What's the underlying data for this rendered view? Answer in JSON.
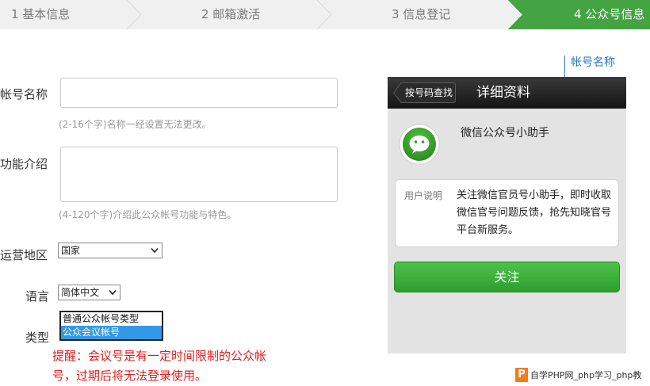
{
  "steps": [
    {
      "label": "1 基本信息",
      "active": false
    },
    {
      "label": "2 邮箱激活",
      "active": false
    },
    {
      "label": "3 信息登记",
      "active": false
    },
    {
      "label": "4 公众号信息",
      "active": true
    }
  ],
  "form": {
    "account_name": {
      "label": "帐号名称",
      "value": "",
      "hint": "(2-16个字)名称一经设置无法更改。"
    },
    "function_intro": {
      "label": "功能介绍",
      "value": "",
      "hint": "(4-120个字)介绍此公众帐号功能与特色。"
    },
    "region": {
      "label": "运营地区",
      "selected": "国家"
    },
    "language": {
      "label": "语言",
      "selected": "简体中文"
    },
    "type": {
      "label": "类型",
      "options": [
        "普通公众帐号类型",
        "公众会议帐号"
      ],
      "selected_index": 1
    },
    "warning": "提醒：会议号是有一定时间限制的公众帐号，过期后将无法登录使用。"
  },
  "annotation": {
    "label": "帐号名称"
  },
  "preview": {
    "back_label": "按号码查找",
    "title": "详细资料",
    "account_name": "微信公众号小助手",
    "desc_label": "用户说明",
    "desc_text": "关注微信官员号小助手，即时收取微信官号问题反馈，抢先知晓官号平台新服务。",
    "follow_label": "关注",
    "avatar_icon": "wechat-logo-icon"
  },
  "watermark": {
    "text": "自学PHP网_php学习_php教"
  },
  "colors": {
    "step_active": "#44a343",
    "warning": "#e02020",
    "annotation": "#2a78c8",
    "follow_button": "#3bb03a"
  }
}
